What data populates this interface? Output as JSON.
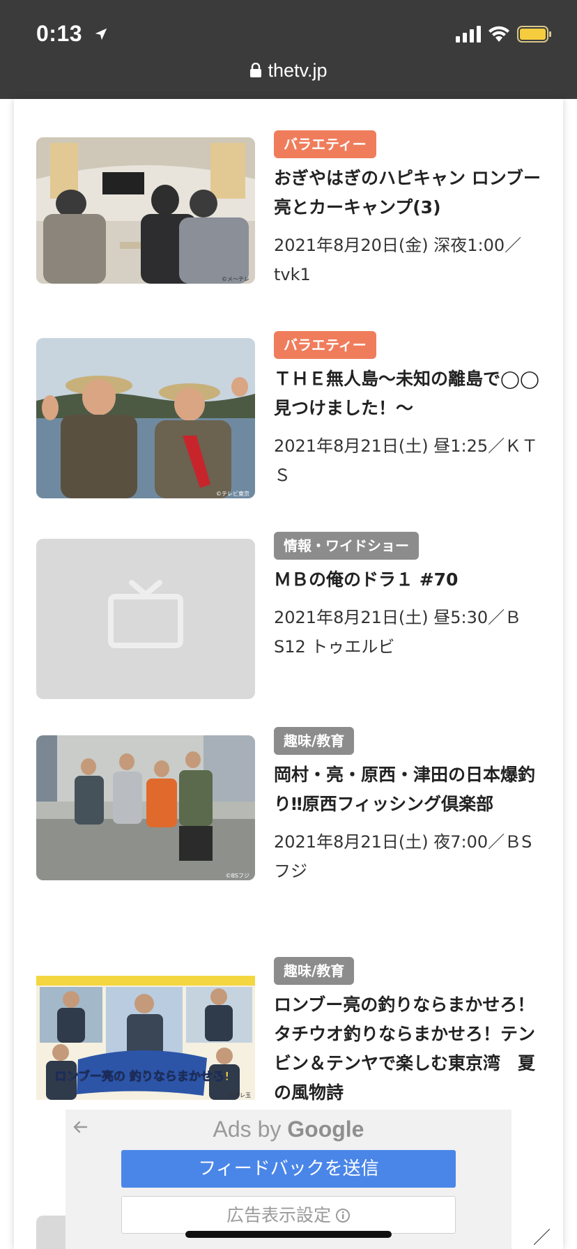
{
  "status_bar": {
    "time": "0:13"
  },
  "address_bar": {
    "domain": "thetv.jp"
  },
  "programs": [
    {
      "genre": "バラエティー",
      "title": "おぎやはぎのハピキャン ロンブー亮とカーキャンプ(3)",
      "schedule": "2021年8月20日(金) 深夜1:00／tvk1",
      "credit": "©メ～テレ"
    },
    {
      "genre": "バラエティー",
      "title": "ＴＨＥ無人島〜未知の離島で◯◯見つけました！〜",
      "schedule": "2021年8月21日(土) 昼1:25／ＫＴＳ",
      "credit": "©テレビ東京"
    },
    {
      "genre": "情報・ワイドショー",
      "title": "ＭＢの俺のドラ１ #70",
      "schedule": "2021年8月21日(土) 昼5:30／ＢS12 トゥエルビ"
    },
    {
      "genre": "趣味/教育",
      "title": "岡村・亮・原西・津田の日本爆釣り‼原西フィッシング倶楽部",
      "schedule": "2021年8月21日(土) 夜7:00／ＢSフジ",
      "credit": "©BSフジ"
    },
    {
      "genre": "趣味/教育",
      "title": "ロンブー亮の釣りならまかせろ！ タチウオ釣りならまかせろ！テンビン＆テンヤで楽しむ東京湾　夏の風物詩",
      "logo_text": "ロンブー亮の 釣りならまかせろ!",
      "credit": "©テレ玉"
    }
  ],
  "cut_text": "／H",
  "ad": {
    "label_prefix": "Ads by",
    "label_brand": "Google",
    "feedback_button": "フィードバックを送信",
    "settings_button": "広告表示設定"
  },
  "colors": {
    "variety_badge": "#ef7d5c",
    "grey_badge": "#8c8c8c",
    "feedback_button": "#4a86e8",
    "topbar": "#3b3b3b"
  }
}
